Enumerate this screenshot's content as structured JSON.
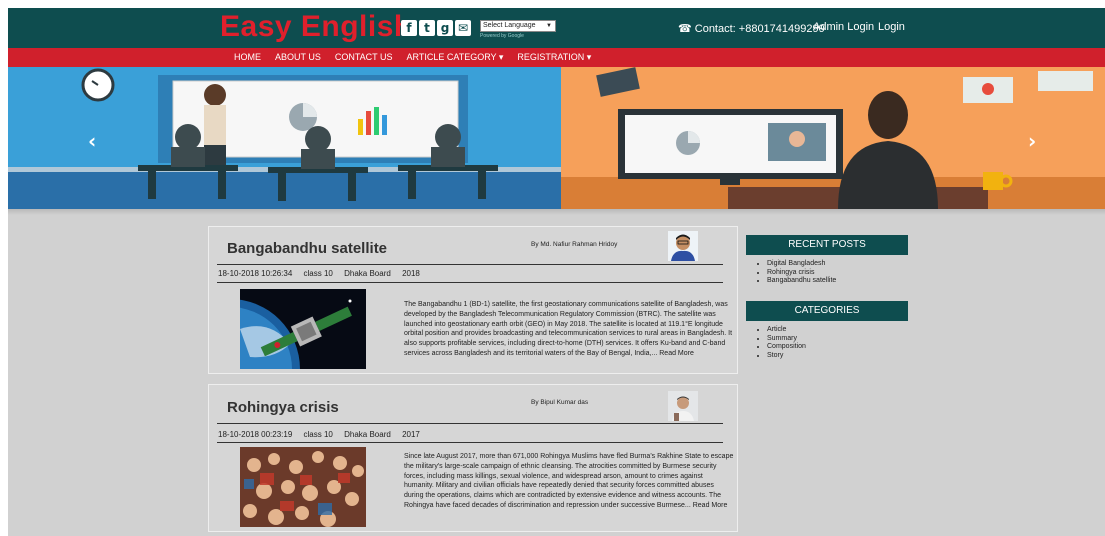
{
  "header": {
    "brand": "Easy English",
    "social_icons": [
      "facebook-icon",
      "twitter-icon",
      "google-plus-icon",
      "email-icon"
    ],
    "language_select": "Select Language",
    "language_powered": "Powered by Google",
    "contact": "☎ Contact: +8801741499299",
    "admin_login": "Admin Login",
    "login": "Login"
  },
  "nav": {
    "items": [
      "HOME",
      "ABOUT US",
      "CONTACT US",
      "ARTICLE CATEGORY ▾",
      "REGISTRATION ▾"
    ]
  },
  "carousel": {
    "prev": "‹",
    "next": "›"
  },
  "posts": [
    {
      "title": "Bangabandhu satellite",
      "author": "By   Md. Nafiur Rahman Hridoy",
      "date": "18-10-2018 10:26:34",
      "class": "class 10",
      "board": "Dhaka Board",
      "year": "2018",
      "excerpt": "The Bangabandhu 1 (BD-1) satellite, the first geostationary communications satellite of Bangladesh, was developed by the Bangladesh Telecommunication Regulatory Commission (BTRC). The satellite was launched into geostationary earth orbit (GEO) in May 2018. The satellite is located at 119.1°E longitude orbital position and provides broadcasting and telecommunication services to rural areas in Bangladesh. It also supports profitable services, including direct-to-home (DTH) services. It offers Ku-band and C-band services across Bangladesh and its territorial waters of the Bay of Bengal, India,...",
      "read_more": "Read More"
    },
    {
      "title": "Rohingya crisis",
      "author": "By   Bipul Kumar das",
      "date": "18-10-2018 00:23:19",
      "class": "class 10",
      "board": "Dhaka Board",
      "year": "2017",
      "excerpt": "Since late August 2017, more than 671,000 Rohingya Muslims have fled Burma's Rakhine State to escape the military's large-scale campaign of ethnic cleansing. The atrocities committed by Burmese security forces, including mass killings, sexual violence, and widespread arson, amount to crimes against humanity. Military and civilian officials have repeatedly denied that security forces committed abuses during the operations, claims which are contradicted by extensive evidence and witness accounts. The Rohingya have faced decades of discrimination and repression under successive Burmese...",
      "read_more": "Read More"
    }
  ],
  "sidebar": {
    "recent_title": "RECENT POSTS",
    "recent": [
      "Digital Bangladesh",
      "Rohingya crisis",
      "Bangabandhu satellite"
    ],
    "categories_title": "CATEGORIES",
    "categories": [
      "Article",
      "Summary",
      "Composition",
      "Story"
    ]
  },
  "colors": {
    "header_bg": "#0e4d4f",
    "accent_red": "#d0202c",
    "page_bg": "#d1d1d1"
  }
}
